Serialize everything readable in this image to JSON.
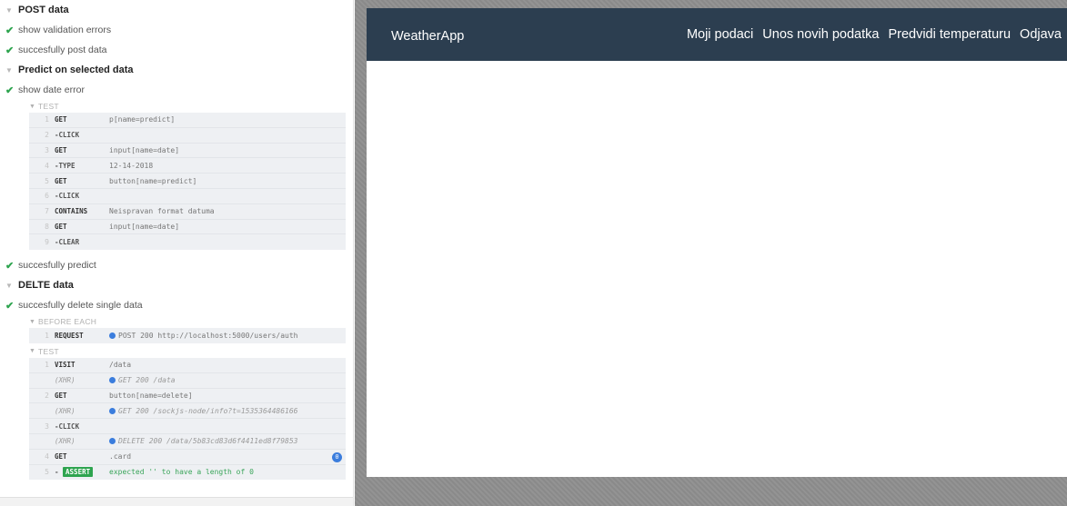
{
  "reporter": {
    "suites": {
      "post": {
        "title": "POST data",
        "tests": [
          "show validation errors",
          "succesfully post data"
        ]
      },
      "predict": {
        "title": "Predict on selected data",
        "test1": "show date error",
        "section": "TEST",
        "commands": [
          {
            "num": "1",
            "name": "GET",
            "msg": "p[name=predict]"
          },
          {
            "num": "2",
            "name": "-CLICK",
            "msg": ""
          },
          {
            "num": "3",
            "name": "GET",
            "msg": "input[name=date]"
          },
          {
            "num": "4",
            "name": "-TYPE",
            "msg": "12-14-2018"
          },
          {
            "num": "5",
            "name": "GET",
            "msg": "button[name=predict]"
          },
          {
            "num": "6",
            "name": "-CLICK",
            "msg": ""
          },
          {
            "num": "7",
            "name": "CONTAINS",
            "msg": "Neispravan format datuma"
          },
          {
            "num": "8",
            "name": "GET",
            "msg": "input[name=date]"
          },
          {
            "num": "9",
            "name": "-CLEAR",
            "msg": ""
          }
        ],
        "test2": "succesfully predict"
      },
      "delete": {
        "title": "DELTE data",
        "test1": "succesfully delete single data",
        "before_each": "BEFORE EACH",
        "before_cmd": {
          "num": "1",
          "name": "REQUEST",
          "msg": "POST 200 http://localhost:5000/users/auth"
        },
        "section": "TEST",
        "commands": [
          {
            "num": "1",
            "name": "VISIT",
            "msg": "/data"
          },
          {
            "num": "",
            "name": "(XHR)",
            "msg": "GET 200 /data"
          },
          {
            "num": "2",
            "name": "GET",
            "msg": "button[name=delete]"
          },
          {
            "num": "",
            "name": "(XHR)",
            "msg": "GET 200 /sockjs-node/info?t=1535364486166"
          },
          {
            "num": "3",
            "name": "-CLICK",
            "msg": ""
          },
          {
            "num": "",
            "name": "(XHR)",
            "msg": "DELETE 200 /data/5b83cd83d6f4411ed8f79853"
          },
          {
            "num": "4",
            "name": "GET",
            "msg": ".card",
            "badge": "0"
          },
          {
            "num": "5",
            "name": "-",
            "assert": "ASSERT",
            "msg": "expected '' to have a length of 0"
          }
        ]
      }
    }
  },
  "app": {
    "brand": "WeatherApp",
    "nav": [
      "Moji podaci",
      "Unos novih podatka",
      "Predvidi temperaturu",
      "Odjava"
    ]
  },
  "colors": {
    "navbar": "#2c3e50",
    "pass": "#2ea44f",
    "xhr_dot": "#3b7ddd"
  }
}
